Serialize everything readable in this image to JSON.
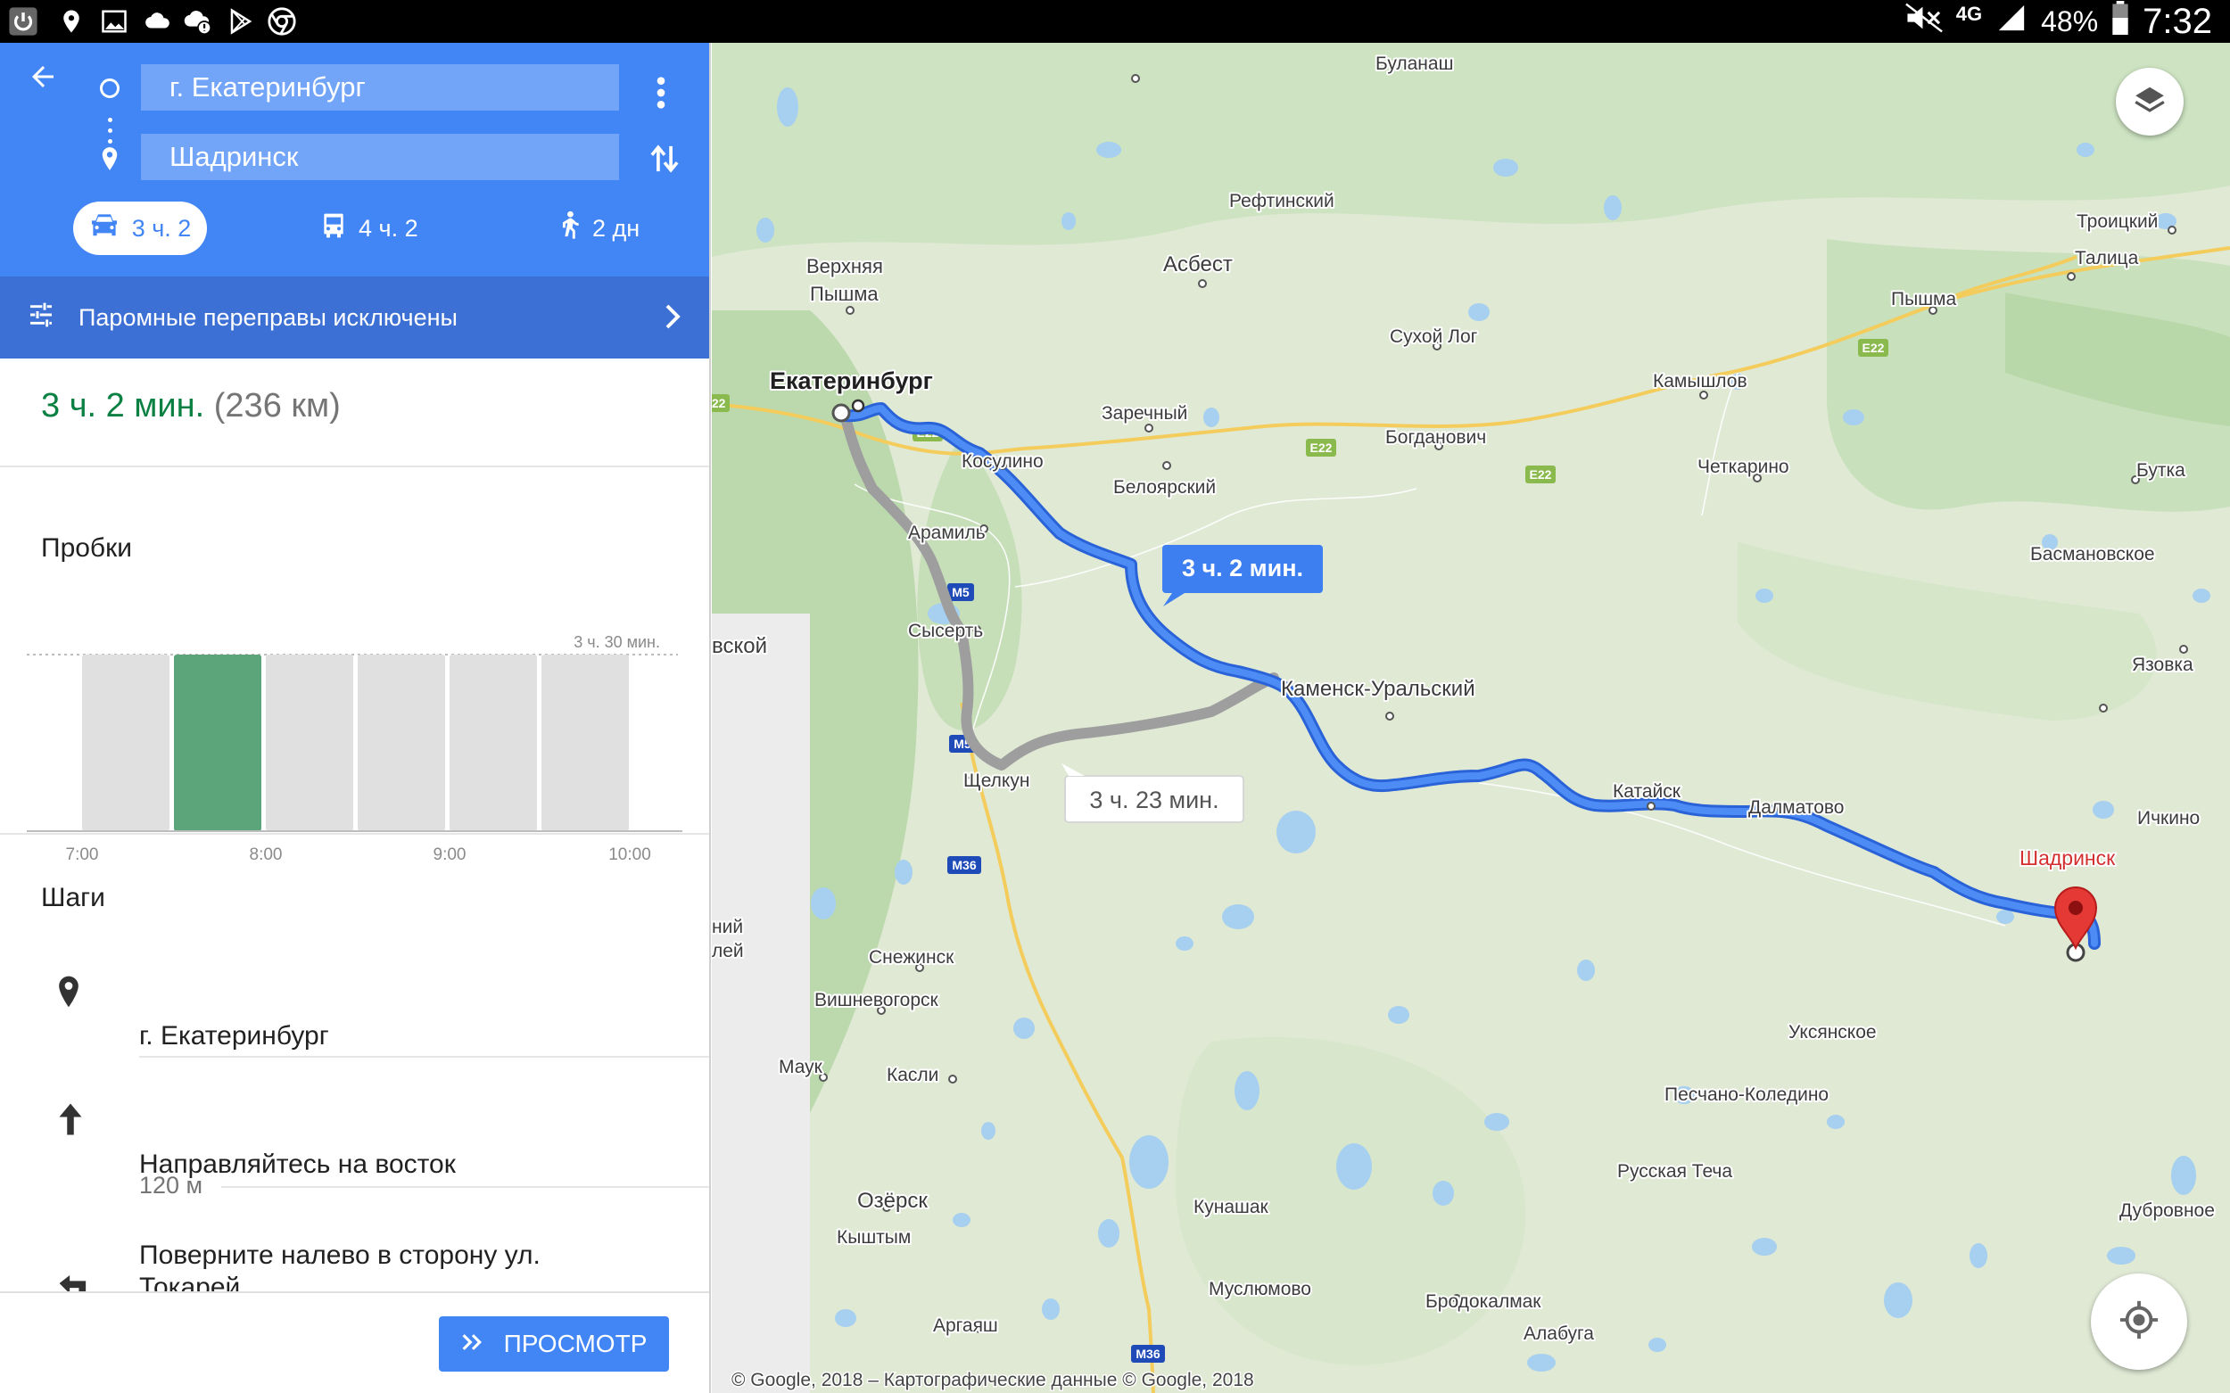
{
  "status_bar": {
    "left_icons": [
      "power-icon",
      "location-icon",
      "image-icon",
      "cloud-icon",
      "cloud-alert-icon",
      "play-store-icon",
      "chrome-icon"
    ],
    "network": "4G",
    "battery": "48%",
    "time": "7:32"
  },
  "directions": {
    "origin": "г. Екатеринбург",
    "destination": "Шадринск",
    "modes": [
      {
        "icon": "car-icon",
        "label": "3 ч. 2",
        "selected": true
      },
      {
        "icon": "bus-icon",
        "label": "4 ч. 2",
        "selected": false
      },
      {
        "icon": "walk-icon",
        "label": "2 дн",
        "selected": false
      }
    ],
    "ferry_notice": "Паромные переправы исключены"
  },
  "summary": {
    "time": "3 ч. 2 мин.",
    "distance": "(236 км)"
  },
  "traffic": {
    "title": "Пробки",
    "max_label": "3 ч. 30 мин.",
    "bars": [
      {
        "fraction": 0.8,
        "highlight": false
      },
      {
        "fraction": 0.8,
        "highlight": true
      },
      {
        "fraction": 0.8,
        "highlight": false
      },
      {
        "fraction": 0.8,
        "highlight": false
      },
      {
        "fraction": 0.8,
        "highlight": false
      },
      {
        "fraction": 0.8,
        "highlight": false
      }
    ],
    "x_labels": [
      "7:00",
      "8:00",
      "9:00",
      "10:00"
    ],
    "highlight_color": "#5ca57a"
  },
  "steps": {
    "title": "Шаги",
    "items": [
      {
        "icon": "pin-icon",
        "text": "г. Екатеринбург"
      },
      {
        "icon": "arrow-up-icon",
        "text": "Направляйтесь на восток",
        "distance": "120 м"
      },
      {
        "icon": "turn-left-icon",
        "text": "Поверните налево в сторону ул. Токарей"
      }
    ]
  },
  "preview_button": "ПРОСМОТР",
  "map": {
    "route_label": "3 ч. 2 мин.",
    "alt_route_label": "3 ч. 23 мин.",
    "destination_label": "Шадринск",
    "copyright": "© Google, 2018 – Картографические данные © Google, 2018",
    "cities": [
      {
        "name": "Екатеринбург",
        "bold": true
      },
      {
        "name": "Буланаш"
      },
      {
        "name": "Рефтинский"
      },
      {
        "name": "Асбест"
      },
      {
        "name": "Верхняя"
      },
      {
        "name": "Пышма"
      },
      {
        "name": "Сухой Лог"
      },
      {
        "name": "Камышлов"
      },
      {
        "name": "Троицкий"
      },
      {
        "name": "Талица"
      },
      {
        "name": "Пышма"
      },
      {
        "name": "Заречный"
      },
      {
        "name": "Богданович"
      },
      {
        "name": "Косулино"
      },
      {
        "name": "Белоярский"
      },
      {
        "name": "Четкарино"
      },
      {
        "name": "Бутка"
      },
      {
        "name": "Басмановское"
      },
      {
        "name": "Арамиль"
      },
      {
        "name": "Сысерть"
      },
      {
        "name": "Каменск-Уральский"
      },
      {
        "name": "Язовка"
      },
      {
        "name": "Щелкун"
      },
      {
        "name": "Катайск"
      },
      {
        "name": "Далматово"
      },
      {
        "name": "Ичкино"
      },
      {
        "name": "Снежинск"
      },
      {
        "name": "Вишневогорск"
      },
      {
        "name": "Маук"
      },
      {
        "name": "Касли"
      },
      {
        "name": "Уксянское"
      },
      {
        "name": "Песчано-Коледино"
      },
      {
        "name": "Русская Теча"
      },
      {
        "name": "Кунашак"
      },
      {
        "name": "Озёрск"
      },
      {
        "name": "Кыштым"
      },
      {
        "name": "Дубровное"
      },
      {
        "name": "Муслюмово"
      },
      {
        "name": "Бродокалмак"
      },
      {
        "name": "Алабуга"
      },
      {
        "name": "Аргаяш"
      },
      {
        "name": "вской"
      },
      {
        "name": "ний"
      },
      {
        "name": "лей"
      }
    ],
    "road_shields": [
      "E22",
      "E22",
      "E22",
      "E22",
      "E22",
      "M5",
      "M5",
      "M36",
      "M36"
    ]
  }
}
